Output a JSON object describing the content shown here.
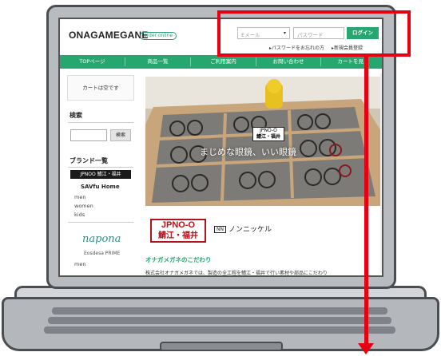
{
  "site": {
    "logo": "ONAGAMEGANE",
    "badge": "order online"
  },
  "login": {
    "email_placeholder": "Eメール",
    "password_placeholder": "パスワード",
    "login_button": "ログイン",
    "forgot_link": "パスワードをお忘れの方",
    "register_link": "新規会員登録"
  },
  "nav": {
    "items": [
      "TOPページ",
      "商品一覧",
      "ご利用案内",
      "お問い合わせ",
      "カートを見る"
    ]
  },
  "sidebar": {
    "cart_status": "カートは空です",
    "search_heading": "検索",
    "search_button": "検索",
    "brand_heading": "ブランド一覧",
    "brand1": "JPNOO 鯖江・福井",
    "brand2": "SAVfu Home",
    "brand2_categories": [
      "men",
      "women",
      "kids"
    ],
    "brand3": "napona",
    "brand4": "Eosdesa PRIME",
    "brand4_categories": [
      "men"
    ]
  },
  "hero": {
    "badge_top": "JPNO-O",
    "badge_bottom": "鯖江・福井",
    "tagline": "まじめな眼鏡、いい眼鏡"
  },
  "brand_logos": {
    "jpno_top": "JPNO-O",
    "jpno_bottom": "鯖江・福井",
    "nonnickel_mark": "NN",
    "nonnickel": "ノンニッケル"
  },
  "content": {
    "section_heading": "オナガメガネのこだわり",
    "body": "株式会社オナガメガネでは、製造の全工程を鯖江・福井で行い素材や部品にこだわり"
  },
  "colors": {
    "accent_green": "#25a76f",
    "highlight_red": "#e60012",
    "brand_red": "#b0131c"
  }
}
